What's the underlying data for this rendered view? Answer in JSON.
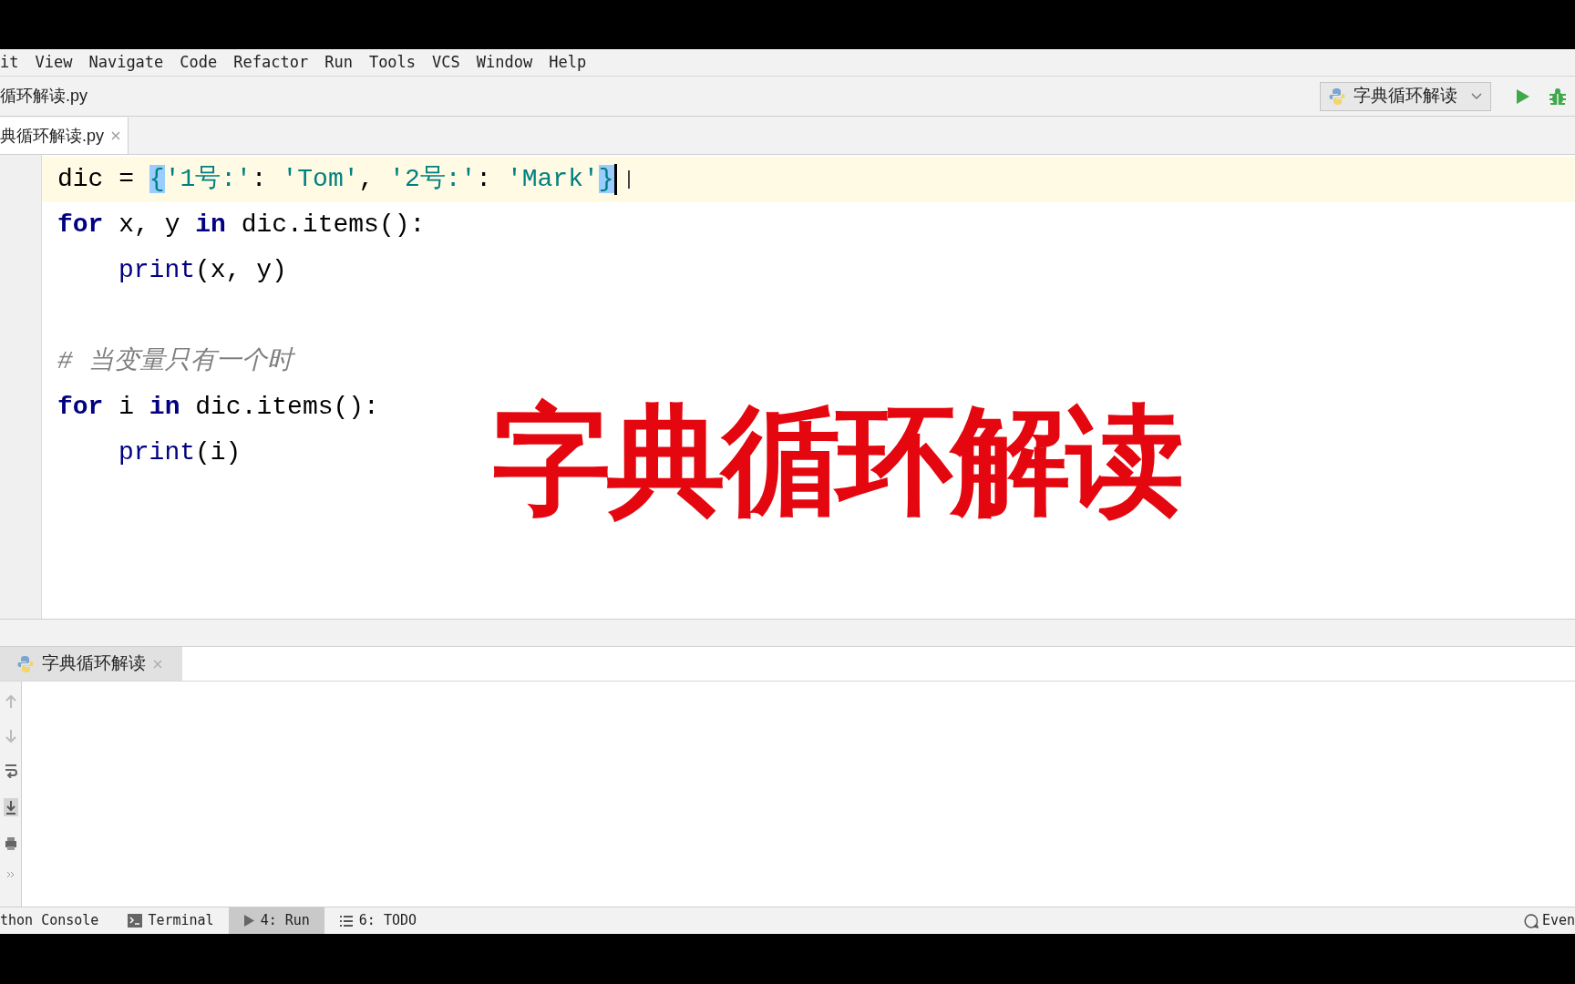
{
  "menu": [
    "it",
    "View",
    "Navigate",
    "Code",
    "Refactor",
    "Run",
    "Tools",
    "VCS",
    "Window",
    "Help"
  ],
  "breadcrumb": "循环解读.py",
  "run_config": {
    "label": "字典循环解读"
  },
  "editor_tabs": [
    {
      "label": "典循环解读.py",
      "selected": true
    }
  ],
  "code_lines": [
    {
      "current": true,
      "tokens": [
        {
          "kind": "plain",
          "text": "dic = "
        },
        {
          "kind": "brace",
          "text": "{"
        },
        {
          "kind": "string",
          "text": "'1号:'"
        },
        {
          "kind": "plain",
          "text": ": "
        },
        {
          "kind": "string",
          "text": "'Tom'"
        },
        {
          "kind": "plain",
          "text": ", "
        },
        {
          "kind": "string",
          "text": "'2号:'"
        },
        {
          "kind": "plain",
          "text": ": "
        },
        {
          "kind": "string",
          "text": "'Mark'"
        },
        {
          "kind": "brace",
          "text": "}"
        }
      ]
    },
    {
      "current": false,
      "tokens": [
        {
          "kind": "keyword",
          "text": "for"
        },
        {
          "kind": "plain",
          "text": " x, y "
        },
        {
          "kind": "keyword",
          "text": "in"
        },
        {
          "kind": "plain",
          "text": " dic.items():"
        }
      ],
      "children": [
        {
          "current": false,
          "tokens": [
            {
              "kind": "builtin",
              "text": "print"
            },
            {
              "kind": "plain",
              "text": "(x, y)"
            }
          ]
        }
      ]
    },
    {
      "current": false
    },
    {
      "current": false,
      "tokens": [
        {
          "kind": "comment",
          "text": "# 当变量只有一个时"
        }
      ]
    },
    {
      "current": false,
      "tokens": [
        {
          "kind": "keyword",
          "text": "for"
        },
        {
          "kind": "plain",
          "text": " i "
        },
        {
          "kind": "keyword",
          "text": "in"
        },
        {
          "kind": "plain",
          "text": " dic.items():"
        }
      ],
      "children": [
        {
          "current": false,
          "tokens": [
            {
              "kind": "builtin",
              "text": "print"
            },
            {
              "kind": "plain",
              "text": "(i)"
            }
          ]
        }
      ]
    }
  ],
  "overlay_title": "字典循环解读",
  "run_tabs": [
    {
      "label": "字典循环解读",
      "selected": true
    }
  ],
  "bottom_tools": [
    {
      "kind": "console",
      "label": "thon Console",
      "selected": false
    },
    {
      "kind": "terminal",
      "label": "Terminal",
      "selected": false
    },
    {
      "kind": "run",
      "label": "4: Run",
      "selected": true
    },
    {
      "kind": "todo",
      "label": "6: TODO",
      "selected": false
    }
  ],
  "event_log": "Even"
}
